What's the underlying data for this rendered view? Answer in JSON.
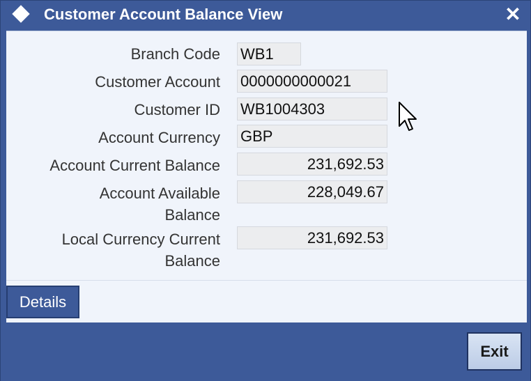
{
  "window": {
    "title": "Customer Account Balance View",
    "close_symbol": "✕"
  },
  "fields": {
    "branch_code": {
      "label": "Branch Code",
      "value": "WB1"
    },
    "customer_account": {
      "label": "Customer Account",
      "value": "0000000000021"
    },
    "customer_id": {
      "label": "Customer ID",
      "value": "WB1004303"
    },
    "account_currency": {
      "label": "Account Currency",
      "value": "GBP"
    },
    "account_current_balance": {
      "label": "Account Current Balance",
      "value": "231,692.53"
    },
    "account_available_balance": {
      "label_line1": "Account Available",
      "label_line2": "Balance",
      "value": "228,049.67"
    },
    "local_currency_current_balance": {
      "label_line1": "Local Currency Current",
      "label_line2": "Balance",
      "value": "231,692.53"
    }
  },
  "buttons": {
    "details": "Details",
    "exit": "Exit"
  },
  "icons": {
    "title": "diamond-icon",
    "close": "close-icon",
    "cursor": "mouse-pointer-icon"
  }
}
